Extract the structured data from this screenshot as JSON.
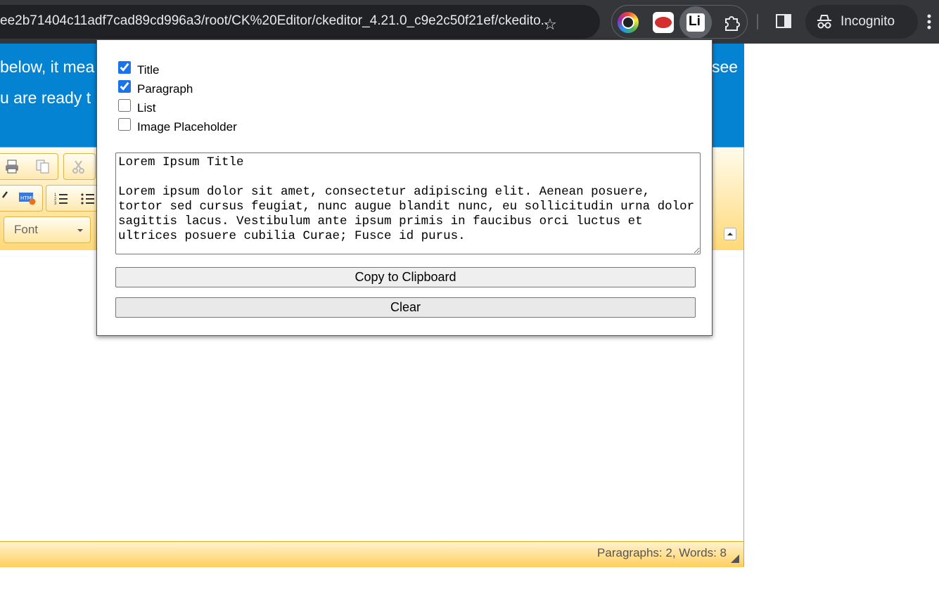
{
  "browser": {
    "url": "ee2b71404c11adf7cad89cd996a3/root/CK%20Editor/ckeditor_4.21.0_c9e2c50f21ef/ckedito...",
    "incognito_label": "Incognito",
    "extensions": [
      "color-picker-extension",
      "ruby-extension",
      "linkedin-extension",
      "puzzle-extensions"
    ]
  },
  "banner": {
    "line1_left": "below, it mea",
    "line1_right": "see",
    "line2_left": "u are ready t"
  },
  "editor": {
    "font_combo_label": "Font",
    "status": "Paragraphs: 2, Words: 8"
  },
  "popup": {
    "options": [
      {
        "label": "Title",
        "checked": true
      },
      {
        "label": "Paragraph",
        "checked": true
      },
      {
        "label": "List",
        "checked": false
      },
      {
        "label": "Image Placeholder",
        "checked": false
      }
    ],
    "output_text": "Lorem Ipsum Title\n\nLorem ipsum dolor sit amet, consectetur adipiscing elit. Aenean posuere, tortor sed cursus feugiat, nunc augue blandit nunc, eu sollicitudin urna dolor sagittis lacus. Vestibulum ante ipsum primis in faucibus orci luctus et ultrices posuere cubilia Curae; Fusce id purus.",
    "copy_button": "Copy to Clipboard",
    "clear_button": "Clear"
  },
  "colors": {
    "banner": "#0383d2",
    "editor_accent": "#ffd978",
    "chrome_bg": "#35363a"
  }
}
